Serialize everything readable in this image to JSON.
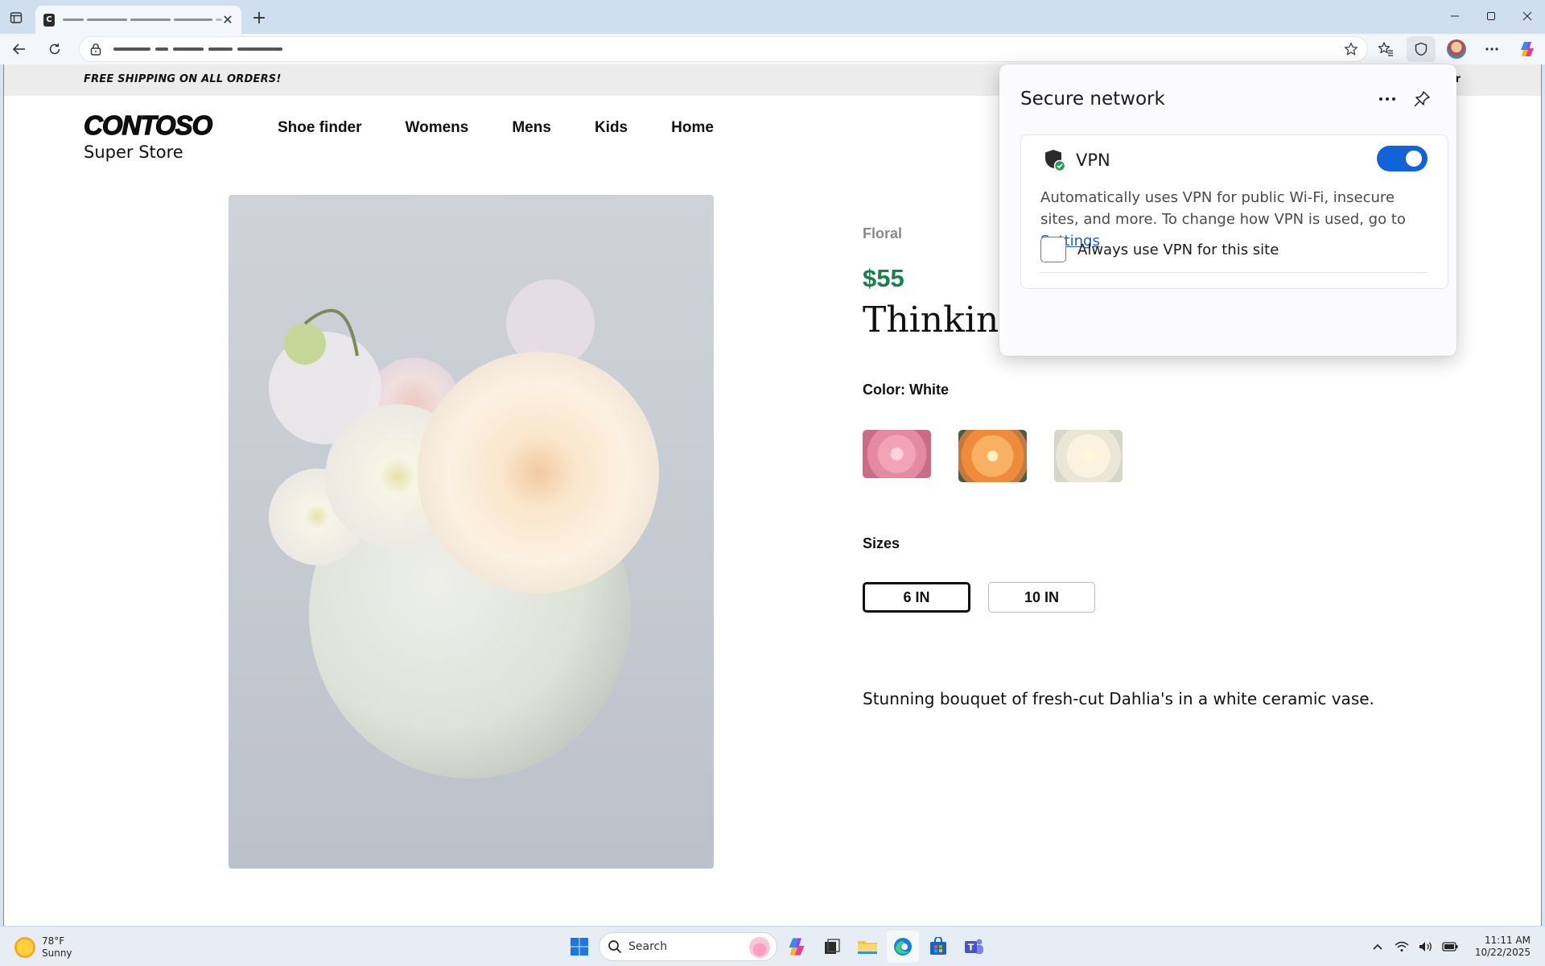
{
  "browser": {
    "new_tab_symbol": "+",
    "close_tab_symbol": "✕",
    "icons": {
      "tab_actions": "tab-actions-icon",
      "favicon": "contoso-favicon-icon",
      "back": "back-arrow-icon",
      "refresh": "refresh-icon",
      "site_info": "lock-icon",
      "favorite": "star-icon",
      "favorites": "favorites-icon",
      "secure_network": "shield-icon",
      "profile": "avatar",
      "more": "ellipsis-icon",
      "copilot": "copilot-icon"
    },
    "favicon_text": "C"
  },
  "promo": {
    "text": "FREE SHIPPING ON ALL ORDERS!",
    "right_partial": "r"
  },
  "store": {
    "logo_main": "CONTOSO",
    "logo_sub": "Super Store",
    "nav": [
      "Shoe finder",
      "Womens",
      "Mens",
      "Kids",
      "Home"
    ]
  },
  "product": {
    "category": "Floral",
    "price": "$55",
    "title_visible": "Thinking",
    "color_label": "Color: White",
    "swatches": [
      "pink dahlia",
      "orange dahlia",
      "white dahlia"
    ],
    "sizes_label": "Sizes",
    "sizes": [
      {
        "label": "6 IN",
        "selected": true
      },
      {
        "label": "10 IN",
        "selected": false
      }
    ],
    "description": "Stunning bouquet of fresh-cut Dahlia's in a white ceramic vase."
  },
  "secure_network": {
    "title": "Secure network",
    "more_label": "···",
    "vpn_label": "VPN",
    "vpn_enabled": true,
    "description_prefix": "Automatically uses VPN for public Wi-Fi, insecure sites, and more. To change how VPN is used, go to ",
    "settings_link": "Settings",
    "always_use_label": "Always use VPN for this site",
    "always_use_checked": false
  },
  "taskbar": {
    "weather_temp": "78°F",
    "weather_desc": "Sunny",
    "search_placeholder": "Search",
    "apps": [
      "copilot-app",
      "task-view",
      "file-explorer",
      "edge",
      "microsoft-store",
      "teams"
    ],
    "time": "11:11 AM",
    "date": "10/22/2025"
  },
  "colors": {
    "price_green": "#1a7f4b",
    "toggle_blue": "#1262d8",
    "link_blue": "#1a5fc6"
  }
}
